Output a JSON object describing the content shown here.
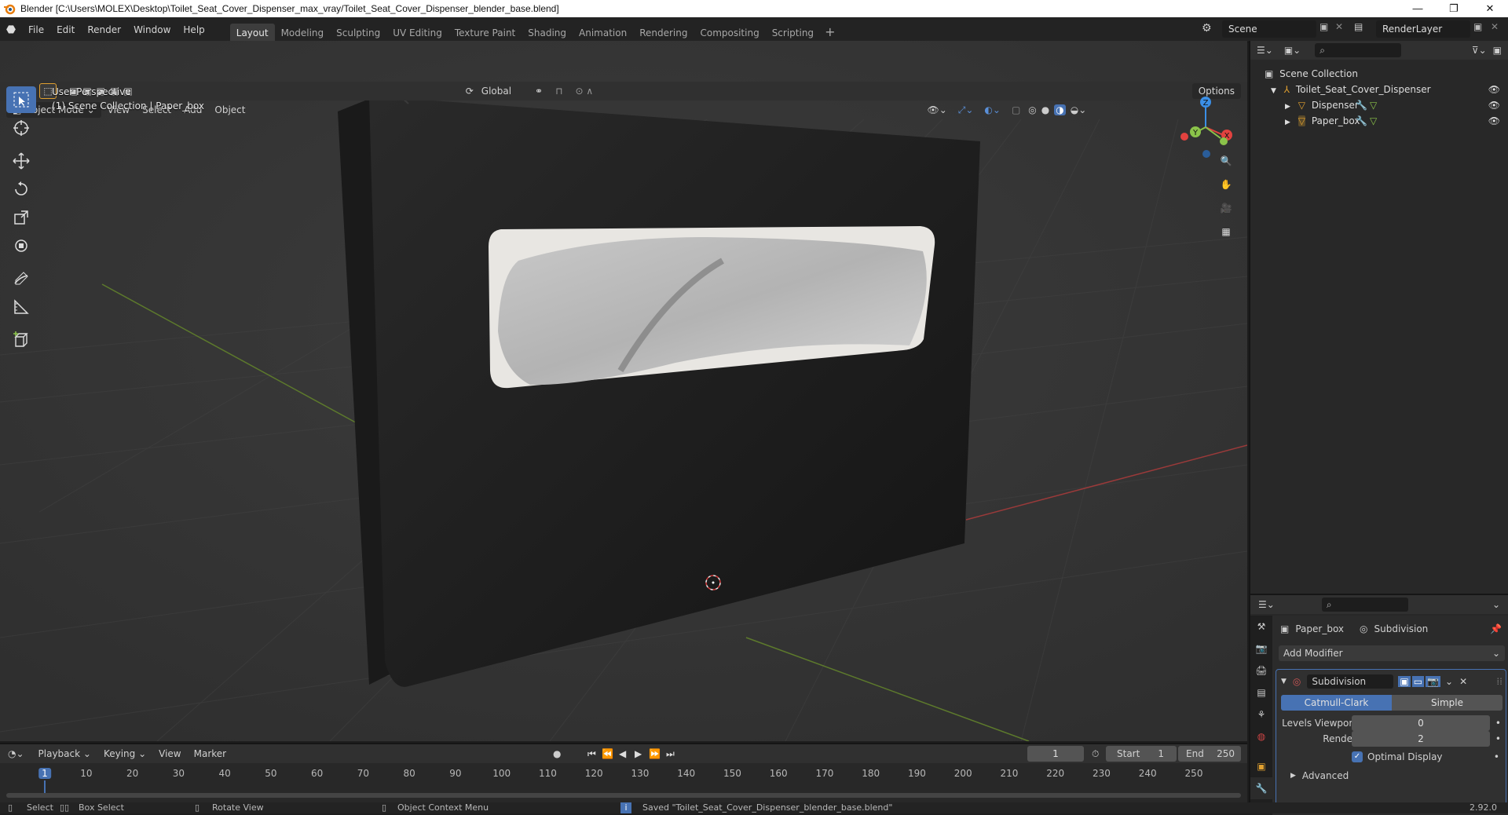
{
  "window": {
    "title": "Blender [C:\\Users\\MOLEX\\Desktop\\Toilet_Seat_Cover_Dispenser_max_vray/Toilet_Seat_Cover_Dispenser_blender_base.blend]",
    "minimize": "—",
    "restore": "❐",
    "close": "✕"
  },
  "menu": [
    "File",
    "Edit",
    "Render",
    "Window",
    "Help"
  ],
  "workspaces": [
    "Layout",
    "Modeling",
    "Sculpting",
    "UV Editing",
    "Texture Paint",
    "Shading",
    "Animation",
    "Rendering",
    "Compositing",
    "Scripting"
  ],
  "workspace_add": "+",
  "scene": "Scene",
  "render_layer": "RenderLayer",
  "viewport_header": {
    "orientation": "Global",
    "options": "Options",
    "mode": "Object Mode",
    "view": "View",
    "select": "Select",
    "add": "Add",
    "object": "Object"
  },
  "viewport": {
    "perspective": "User Perspective",
    "collection_info": "(1) Scene Collection | Paper_box"
  },
  "gizmo": {
    "z": "Z",
    "y": "Y",
    "x": "X"
  },
  "outliner": {
    "root": "Scene Collection",
    "collection": "Toilet_Seat_Cover_Dispenser",
    "objects": [
      "Dispenser",
      "Paper_box"
    ]
  },
  "properties": {
    "object_name": "Paper_box",
    "modifier_ref": "Subdivision",
    "add_modifier": "Add Modifier",
    "modifier_name": "Subdivision",
    "catmull": "Catmull-Clark",
    "simple": "Simple",
    "levels_viewport_label": "Levels Viewport",
    "levels_viewport_value": "0",
    "render_label": "Render",
    "render_value": "2",
    "optimal_display": "Optimal Display",
    "optimal_checked": true,
    "advanced": "Advanced"
  },
  "timeline": {
    "playback": "Playback",
    "keying": "Keying",
    "view": "View",
    "marker": "Marker",
    "current_frame": "1",
    "start_label": "Start",
    "start_value": "1",
    "end_label": "End",
    "end_value": "250",
    "ticks": [
      "1",
      "10",
      "20",
      "30",
      "40",
      "50",
      "60",
      "70",
      "80",
      "90",
      "100",
      "110",
      "120",
      "130",
      "140",
      "150",
      "160",
      "170",
      "180",
      "190",
      "200",
      "210",
      "220",
      "230",
      "240",
      "250"
    ]
  },
  "status": {
    "select": "Select",
    "box_select": "Box Select",
    "rotate_view": "Rotate View",
    "context_menu": "Object Context Menu",
    "message": "Saved \"Toilet_Seat_Cover_Dispenser_blender_base.blend\"",
    "version": "2.92.0"
  },
  "colors": {
    "accent": "#4772b3",
    "x_axis": "#e2423f",
    "y_axis": "#8bc34a",
    "z_axis": "#3b8fe6"
  }
}
